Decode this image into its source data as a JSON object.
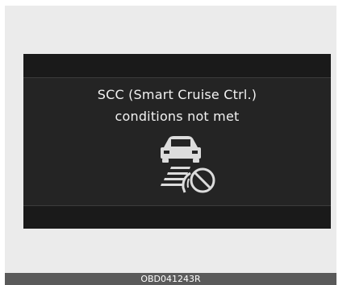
{
  "display": {
    "message_line1": "SCC (Smart Cruise Ctrl.)",
    "message_line2": "conditions not met",
    "icon": "scc-unavailable-icon"
  },
  "footer": {
    "code": "OBD041243R"
  },
  "colors": {
    "screen_background": "#242424",
    "screen_bars": "#1a1a1a",
    "text": "#f2f2f2",
    "icon": "#dcdcdc",
    "page_background": "#ebebeb",
    "footer_background": "#5a5a5a"
  }
}
